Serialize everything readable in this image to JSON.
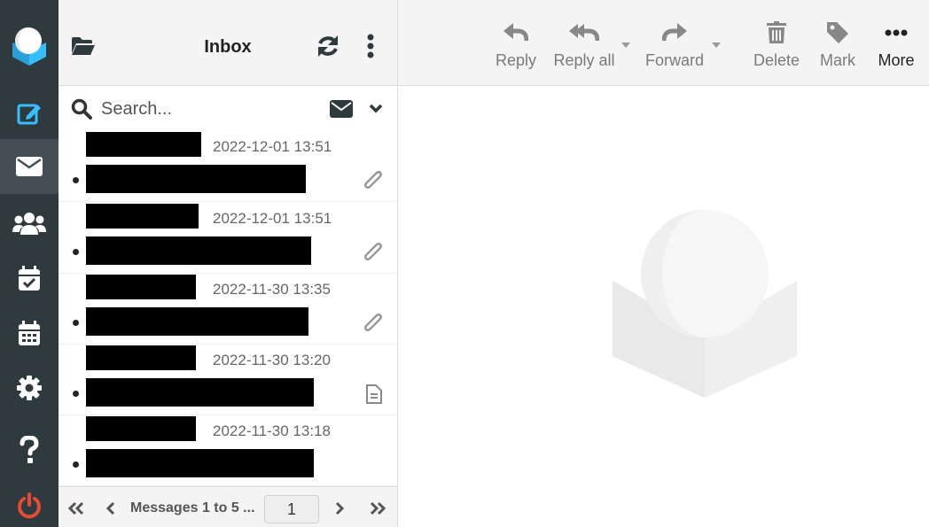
{
  "app": {
    "name": "Roundcube Webmail"
  },
  "rail": {
    "items": [
      {
        "name": "compose",
        "icon": "compose-icon"
      },
      {
        "name": "mail",
        "icon": "envelope-icon",
        "active": true
      },
      {
        "name": "contacts",
        "icon": "users-icon"
      },
      {
        "name": "tasks",
        "icon": "calendar-check-icon"
      },
      {
        "name": "calendar",
        "icon": "calendar-icon"
      },
      {
        "name": "settings",
        "icon": "gear-icon"
      },
      {
        "name": "help",
        "icon": "question-icon"
      },
      {
        "name": "logout",
        "icon": "power-icon"
      }
    ],
    "accent": "#37beff",
    "logout_color": "#e64a33"
  },
  "list": {
    "title": "Inbox",
    "search_placeholder": "Search...",
    "messages": [
      {
        "date": "2022-12-01 13:51",
        "icon": "paperclip-icon",
        "unread": true
      },
      {
        "date": "2022-12-01 13:51",
        "icon": "paperclip-icon",
        "unread": true
      },
      {
        "date": "2022-11-30 13:35",
        "icon": "paperclip-icon",
        "unread": true
      },
      {
        "date": "2022-11-30 13:20",
        "icon": "document-icon",
        "unread": true
      },
      {
        "date": "2022-11-30 13:18",
        "icon": "",
        "unread": true
      }
    ],
    "pager": {
      "text": "Messages 1 to 5 ...",
      "page": "1"
    }
  },
  "toolbar": {
    "reply": "Reply",
    "reply_all": "Reply all",
    "forward": "Forward",
    "delete": "Delete",
    "mark": "Mark",
    "more": "More"
  }
}
